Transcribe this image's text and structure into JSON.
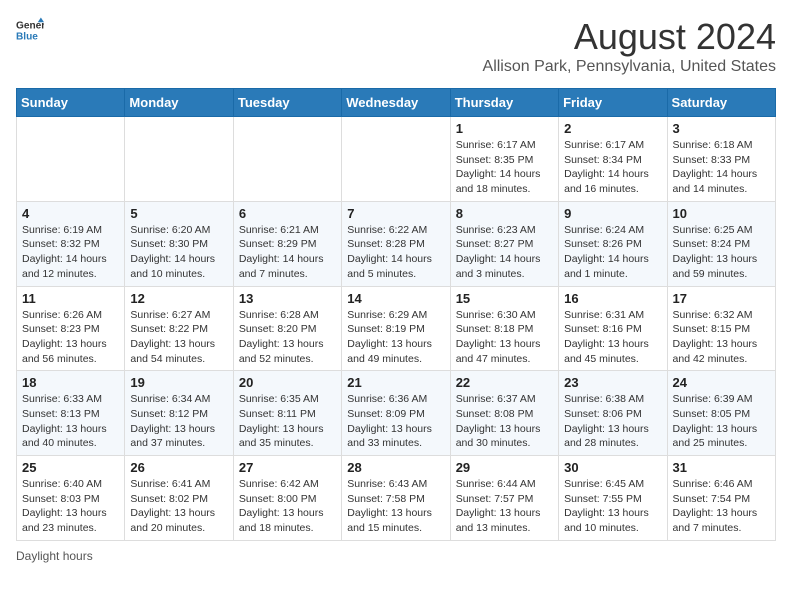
{
  "header": {
    "logo_line1": "General",
    "logo_line2": "Blue",
    "month_year": "August 2024",
    "location": "Allison Park, Pennsylvania, United States"
  },
  "days_of_week": [
    "Sunday",
    "Monday",
    "Tuesday",
    "Wednesday",
    "Thursday",
    "Friday",
    "Saturday"
  ],
  "weeks": [
    [
      {
        "day": "",
        "info": ""
      },
      {
        "day": "",
        "info": ""
      },
      {
        "day": "",
        "info": ""
      },
      {
        "day": "",
        "info": ""
      },
      {
        "day": "1",
        "info": "Sunrise: 6:17 AM\nSunset: 8:35 PM\nDaylight: 14 hours\nand 18 minutes."
      },
      {
        "day": "2",
        "info": "Sunrise: 6:17 AM\nSunset: 8:34 PM\nDaylight: 14 hours\nand 16 minutes."
      },
      {
        "day": "3",
        "info": "Sunrise: 6:18 AM\nSunset: 8:33 PM\nDaylight: 14 hours\nand 14 minutes."
      }
    ],
    [
      {
        "day": "4",
        "info": "Sunrise: 6:19 AM\nSunset: 8:32 PM\nDaylight: 14 hours\nand 12 minutes."
      },
      {
        "day": "5",
        "info": "Sunrise: 6:20 AM\nSunset: 8:30 PM\nDaylight: 14 hours\nand 10 minutes."
      },
      {
        "day": "6",
        "info": "Sunrise: 6:21 AM\nSunset: 8:29 PM\nDaylight: 14 hours\nand 7 minutes."
      },
      {
        "day": "7",
        "info": "Sunrise: 6:22 AM\nSunset: 8:28 PM\nDaylight: 14 hours\nand 5 minutes."
      },
      {
        "day": "8",
        "info": "Sunrise: 6:23 AM\nSunset: 8:27 PM\nDaylight: 14 hours\nand 3 minutes."
      },
      {
        "day": "9",
        "info": "Sunrise: 6:24 AM\nSunset: 8:26 PM\nDaylight: 14 hours\nand 1 minute."
      },
      {
        "day": "10",
        "info": "Sunrise: 6:25 AM\nSunset: 8:24 PM\nDaylight: 13 hours\nand 59 minutes."
      }
    ],
    [
      {
        "day": "11",
        "info": "Sunrise: 6:26 AM\nSunset: 8:23 PM\nDaylight: 13 hours\nand 56 minutes."
      },
      {
        "day": "12",
        "info": "Sunrise: 6:27 AM\nSunset: 8:22 PM\nDaylight: 13 hours\nand 54 minutes."
      },
      {
        "day": "13",
        "info": "Sunrise: 6:28 AM\nSunset: 8:20 PM\nDaylight: 13 hours\nand 52 minutes."
      },
      {
        "day": "14",
        "info": "Sunrise: 6:29 AM\nSunset: 8:19 PM\nDaylight: 13 hours\nand 49 minutes."
      },
      {
        "day": "15",
        "info": "Sunrise: 6:30 AM\nSunset: 8:18 PM\nDaylight: 13 hours\nand 47 minutes."
      },
      {
        "day": "16",
        "info": "Sunrise: 6:31 AM\nSunset: 8:16 PM\nDaylight: 13 hours\nand 45 minutes."
      },
      {
        "day": "17",
        "info": "Sunrise: 6:32 AM\nSunset: 8:15 PM\nDaylight: 13 hours\nand 42 minutes."
      }
    ],
    [
      {
        "day": "18",
        "info": "Sunrise: 6:33 AM\nSunset: 8:13 PM\nDaylight: 13 hours\nand 40 minutes."
      },
      {
        "day": "19",
        "info": "Sunrise: 6:34 AM\nSunset: 8:12 PM\nDaylight: 13 hours\nand 37 minutes."
      },
      {
        "day": "20",
        "info": "Sunrise: 6:35 AM\nSunset: 8:11 PM\nDaylight: 13 hours\nand 35 minutes."
      },
      {
        "day": "21",
        "info": "Sunrise: 6:36 AM\nSunset: 8:09 PM\nDaylight: 13 hours\nand 33 minutes."
      },
      {
        "day": "22",
        "info": "Sunrise: 6:37 AM\nSunset: 8:08 PM\nDaylight: 13 hours\nand 30 minutes."
      },
      {
        "day": "23",
        "info": "Sunrise: 6:38 AM\nSunset: 8:06 PM\nDaylight: 13 hours\nand 28 minutes."
      },
      {
        "day": "24",
        "info": "Sunrise: 6:39 AM\nSunset: 8:05 PM\nDaylight: 13 hours\nand 25 minutes."
      }
    ],
    [
      {
        "day": "25",
        "info": "Sunrise: 6:40 AM\nSunset: 8:03 PM\nDaylight: 13 hours\nand 23 minutes."
      },
      {
        "day": "26",
        "info": "Sunrise: 6:41 AM\nSunset: 8:02 PM\nDaylight: 13 hours\nand 20 minutes."
      },
      {
        "day": "27",
        "info": "Sunrise: 6:42 AM\nSunset: 8:00 PM\nDaylight: 13 hours\nand 18 minutes."
      },
      {
        "day": "28",
        "info": "Sunrise: 6:43 AM\nSunset: 7:58 PM\nDaylight: 13 hours\nand 15 minutes."
      },
      {
        "day": "29",
        "info": "Sunrise: 6:44 AM\nSunset: 7:57 PM\nDaylight: 13 hours\nand 13 minutes."
      },
      {
        "day": "30",
        "info": "Sunrise: 6:45 AM\nSunset: 7:55 PM\nDaylight: 13 hours\nand 10 minutes."
      },
      {
        "day": "31",
        "info": "Sunrise: 6:46 AM\nSunset: 7:54 PM\nDaylight: 13 hours\nand 7 minutes."
      }
    ]
  ],
  "footer": {
    "daylight_label": "Daylight hours"
  }
}
